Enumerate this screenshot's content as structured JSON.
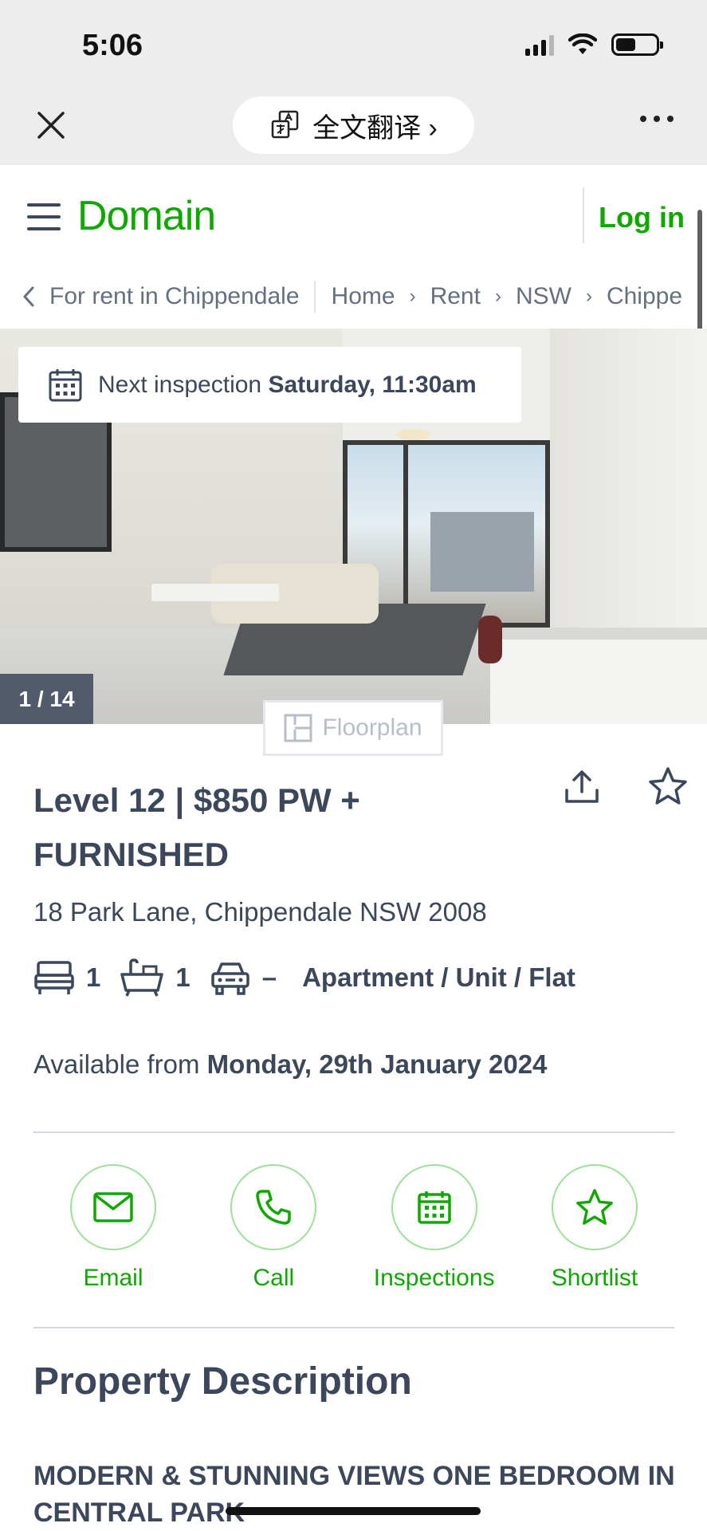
{
  "status_bar": {
    "time": "5:06"
  },
  "top_bar": {
    "translate_label": "全文翻译 ›"
  },
  "header": {
    "logo": "Domain",
    "login": "Log in"
  },
  "breadcrumb": {
    "back_label": "For rent in Chippendale",
    "items": [
      "Home",
      "Rent",
      "NSW",
      "Chippe"
    ]
  },
  "hero": {
    "inspection_label": "Next inspection",
    "inspection_time": "Saturday, 11:30am",
    "photo_count": "1 / 14",
    "floorplan_label": "Floorplan"
  },
  "listing": {
    "title": "Level 12 | $850 PW + FURNISHED",
    "address": "18 Park Lane, Chippendale NSW 2008",
    "beds": "1",
    "baths": "1",
    "parking": "–",
    "property_type": "Apartment / Unit / Flat",
    "available_label": "Available from",
    "available_date": "Monday, 29th January 2024"
  },
  "actions": {
    "email": "Email",
    "call": "Call",
    "inspections": "Inspections",
    "shortlist": "Shortlist"
  },
  "description": {
    "section_title": "Property Description",
    "heading": "MODERN & STUNNING VIEWS ONE BEDROOM IN CENTRAL PARK"
  },
  "colors": {
    "brand_green": "#0ea800",
    "text_dark": "#3c475b",
    "text_muted": "#647082"
  }
}
